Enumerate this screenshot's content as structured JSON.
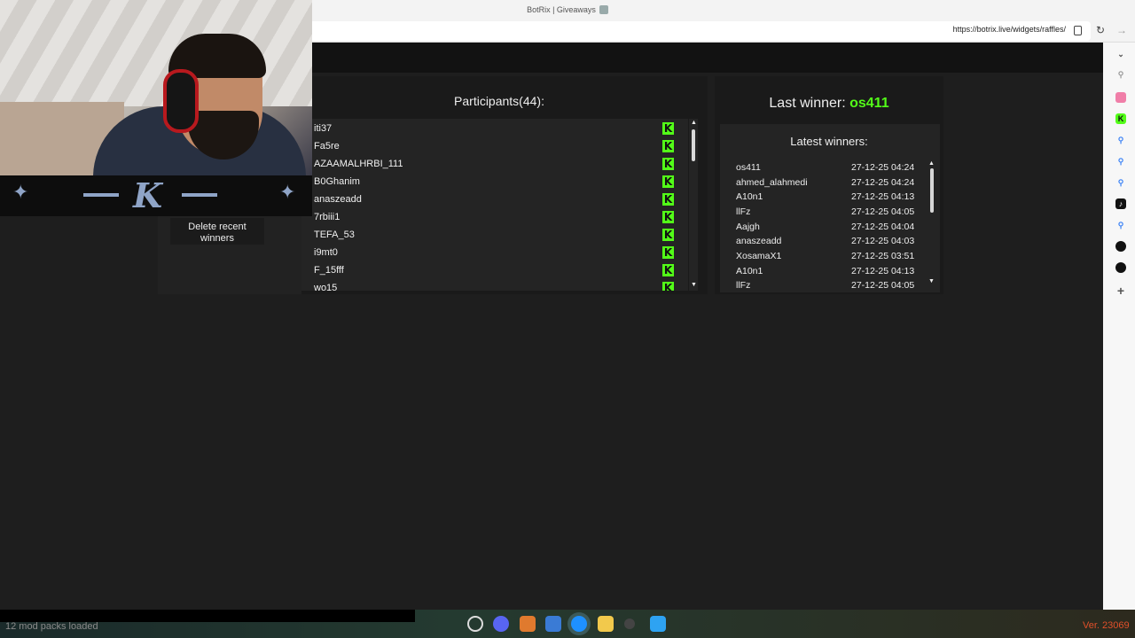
{
  "browser": {
    "tab_title": "BotRix | Giveaways",
    "url": "https://botrix.live/widgets/raffles/"
  },
  "left_panel": {
    "delete_label": "Delete recent winners"
  },
  "participants": {
    "title": "Participants(44):",
    "rows": [
      "iti37",
      "Fa5re",
      "AZAAMALHRBI_111",
      "B0Ghanim",
      "anaszeadd",
      "7rbiii1",
      "TEFA_53",
      "i9mt0",
      "F_15fff",
      "wo15"
    ],
    "platform_icon": "kick-icon"
  },
  "winner": {
    "last_label": "Last winner:",
    "last_name": "os411",
    "latest_title": "Latest winners:",
    "latest": [
      {
        "name": "os411",
        "date": "27-12-25 04:24"
      },
      {
        "name": "ahmed_alahmedi",
        "date": "27-12-25 04:24"
      },
      {
        "name": "A10n1",
        "date": "27-12-25 04:13"
      },
      {
        "name": "llFz",
        "date": "27-12-25 04:05"
      },
      {
        "name": "Aajgh",
        "date": "27-12-25 04:04"
      },
      {
        "name": "anaszeadd",
        "date": "27-12-25 04:03"
      },
      {
        "name": "XosamaX1",
        "date": "27-12-25 03:51"
      },
      {
        "name": "A10n1",
        "date": "27-12-25 04:13"
      },
      {
        "name": "llFz",
        "date": "27-12-25 04:05"
      }
    ]
  },
  "taskbar": {
    "mods": "12 mod packs loaded",
    "version": "Ver. 23069"
  },
  "colors": {
    "accent": "#53fc18",
    "background": "#1e1e1e",
    "panel": "#242424"
  }
}
